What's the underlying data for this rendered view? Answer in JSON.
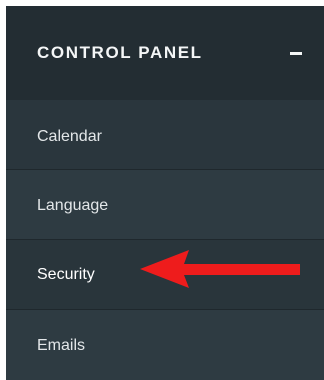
{
  "control_panel": {
    "title": "CONTROL PANEL",
    "collapse_icon": "minus-icon",
    "items": [
      {
        "label": "Calendar"
      },
      {
        "label": "Language"
      },
      {
        "label": "Security",
        "active": true
      },
      {
        "label": "Emails"
      }
    ]
  },
  "annotation": {
    "icon": "arrow-left-icon",
    "color": "#ee1c1c"
  }
}
